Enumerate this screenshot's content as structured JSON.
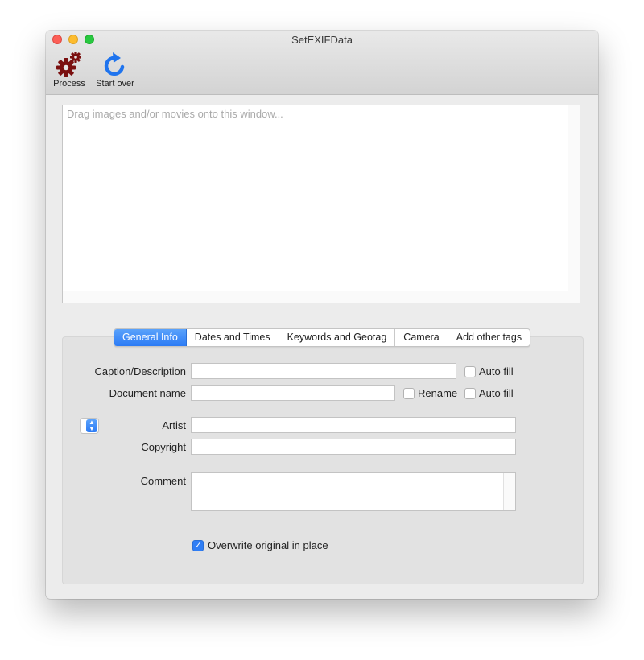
{
  "window": {
    "title": "SetEXIFData"
  },
  "toolbar": {
    "process_label": "Process",
    "process_icon": "gears-icon",
    "start_over_label": "Start over",
    "start_over_icon": "refresh-icon"
  },
  "dropzone": {
    "placeholder": "Drag images and/or movies onto this window..."
  },
  "tabs": [
    {
      "label": "General Info",
      "active": true
    },
    {
      "label": "Dates and Times",
      "active": false
    },
    {
      "label": "Keywords and Geotag",
      "active": false
    },
    {
      "label": "Camera",
      "active": false
    },
    {
      "label": "Add other tags",
      "active": false
    }
  ],
  "form": {
    "caption_label": "Caption/Description",
    "caption_value": "",
    "caption_autofill_label": "Auto fill",
    "caption_autofill_checked": false,
    "docname_label": "Document name",
    "docname_value": "",
    "rename_label": "Rename",
    "rename_checked": false,
    "docname_autofill_label": "Auto fill",
    "docname_autofill_checked": false,
    "artist_label": "Artist",
    "artist_value": "",
    "copyright_label": "Copyright",
    "copyright_value": "",
    "comment_label": "Comment",
    "comment_value": "",
    "overwrite_label": "Overwrite original in place",
    "overwrite_checked": true
  },
  "colors": {
    "accent": "#2f7ef6",
    "gear": "#7a0f0f",
    "refresh": "#1f74ee"
  }
}
